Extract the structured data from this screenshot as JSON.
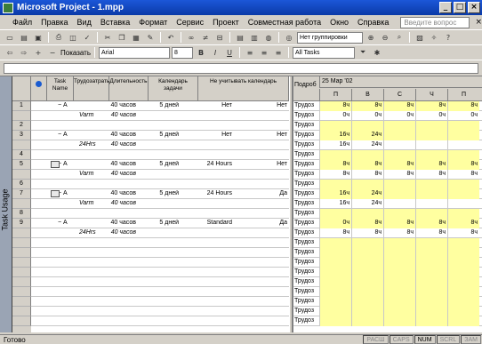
{
  "title": "Microsoft Project - 1.mpp",
  "menu": [
    "Файл",
    "Правка",
    "Вид",
    "Вставка",
    "Формат",
    "Сервис",
    "Проект",
    "Совместная работа",
    "Окно",
    "Справка"
  ],
  "help_placeholder": "Введите вопрос",
  "toolbar1": {
    "grouping": "Нет группировки"
  },
  "toolbar2": {
    "show_label": "Показать",
    "font": "Arial",
    "size": "8",
    "filter": "All Tasks"
  },
  "view_label": "Task Usage",
  "columns": [
    "",
    "Task Name",
    "Трудозатраты",
    "Длительность",
    "Календарь задачи",
    "Не учитывать календарь"
  ],
  "rows": [
    {
      "num": "1",
      "name": "А",
      "work": "40 часов",
      "dur": "5 дней",
      "cal": "Нет",
      "ign": "Нет",
      "lbl": "Трудоз",
      "cells": [
        "8ч",
        "8ч",
        "8ч",
        "8ч",
        "8ч"
      ],
      "y": true
    },
    {
      "num": "",
      "name": "Varm",
      "work": "40 часов",
      "dur": "",
      "cal": "",
      "ign": "",
      "lbl": "Трудоз",
      "cells": [
        "0ч",
        "0ч",
        "0ч",
        "0ч",
        "0ч"
      ],
      "y": false
    },
    {
      "num": "2",
      "name": "",
      "work": "",
      "dur": "",
      "cal": "",
      "ign": "",
      "lbl": "Трудоз",
      "cells": [
        "",
        "",
        "",
        "",
        ""
      ],
      "y": true
    },
    {
      "num": "3",
      "name": "А",
      "work": "40 часов",
      "dur": "5 дней",
      "cal": "Нет",
      "ign": "Нет",
      "lbl": "Трудоз",
      "cells": [
        "16ч",
        "24ч",
        "",
        "",
        ""
      ],
      "y": true
    },
    {
      "num": "",
      "name": "24Hrs",
      "work": "40 часов",
      "dur": "",
      "cal": "",
      "ign": "",
      "lbl": "Трудоз",
      "cells": [
        "16ч",
        "24ч",
        "",
        "",
        ""
      ],
      "y": false
    },
    {
      "num": "4",
      "name": "",
      "work": "",
      "dur": "",
      "cal": "",
      "ign": "",
      "lbl": "Трудоз",
      "cells": [
        "",
        "",
        "",
        "",
        ""
      ],
      "y": true
    },
    {
      "num": "5",
      "name": "А",
      "work": "40 часов",
      "dur": "5 дней",
      "cal": "24 Hours",
      "ign": "Нет",
      "lbl": "Трудоз",
      "cells": [
        "8ч",
        "8ч",
        "8ч",
        "8ч",
        "8ч"
      ],
      "y": true
    },
    {
      "num": "",
      "name": "Varm",
      "work": "40 часов",
      "dur": "",
      "cal": "",
      "ign": "",
      "lbl": "Трудоз",
      "cells": [
        "8ч",
        "8ч",
        "8ч",
        "8ч",
        "8ч"
      ],
      "y": false
    },
    {
      "num": "6",
      "name": "",
      "work": "",
      "dur": "",
      "cal": "",
      "ign": "",
      "lbl": "Трудоз",
      "cells": [
        "",
        "",
        "",
        "",
        ""
      ],
      "y": true
    },
    {
      "num": "7",
      "name": "А",
      "work": "40 часов",
      "dur": "5 дней",
      "cal": "24 Hours",
      "ign": "Да",
      "lbl": "Трудоз",
      "cells": [
        "16ч",
        "24ч",
        "",
        "",
        ""
      ],
      "y": true
    },
    {
      "num": "",
      "name": "Varm",
      "work": "40 часов",
      "dur": "",
      "cal": "",
      "ign": "",
      "lbl": "Трудоз",
      "cells": [
        "16ч",
        "24ч",
        "",
        "",
        ""
      ],
      "y": false
    },
    {
      "num": "8",
      "name": "",
      "work": "",
      "dur": "",
      "cal": "",
      "ign": "",
      "lbl": "Трудоз",
      "cells": [
        "",
        "",
        "",
        "",
        ""
      ],
      "y": true
    },
    {
      "num": "9",
      "name": "А",
      "work": "40 часов",
      "dur": "5 дней",
      "cal": "Standard",
      "ign": "Да",
      "lbl": "Трудоз",
      "cells": [
        "0ч",
        "8ч",
        "8ч",
        "8ч",
        "8ч"
      ],
      "y": true
    },
    {
      "num": "",
      "name": "24Hrs",
      "work": "40 часов",
      "dur": "",
      "cal": "",
      "ign": "",
      "lbl": "Трудоз",
      "cells": [
        "8ч",
        "8ч",
        "8ч",
        "8ч",
        "8ч"
      ],
      "y": false
    }
  ],
  "timephased": {
    "label": "Подроб",
    "date": "25 Мар '02",
    "days": [
      "П",
      "В",
      "С",
      "Ч",
      "П"
    ],
    "empty_label": "Трудоз"
  },
  "status": {
    "text": "Готово",
    "indicators": [
      "РАСШ",
      "CAPS",
      "NUM",
      "SCRL",
      "ЗАМ"
    ]
  },
  "colors": {
    "yellow": "#ffffa0",
    "title": "#1c57d8"
  }
}
